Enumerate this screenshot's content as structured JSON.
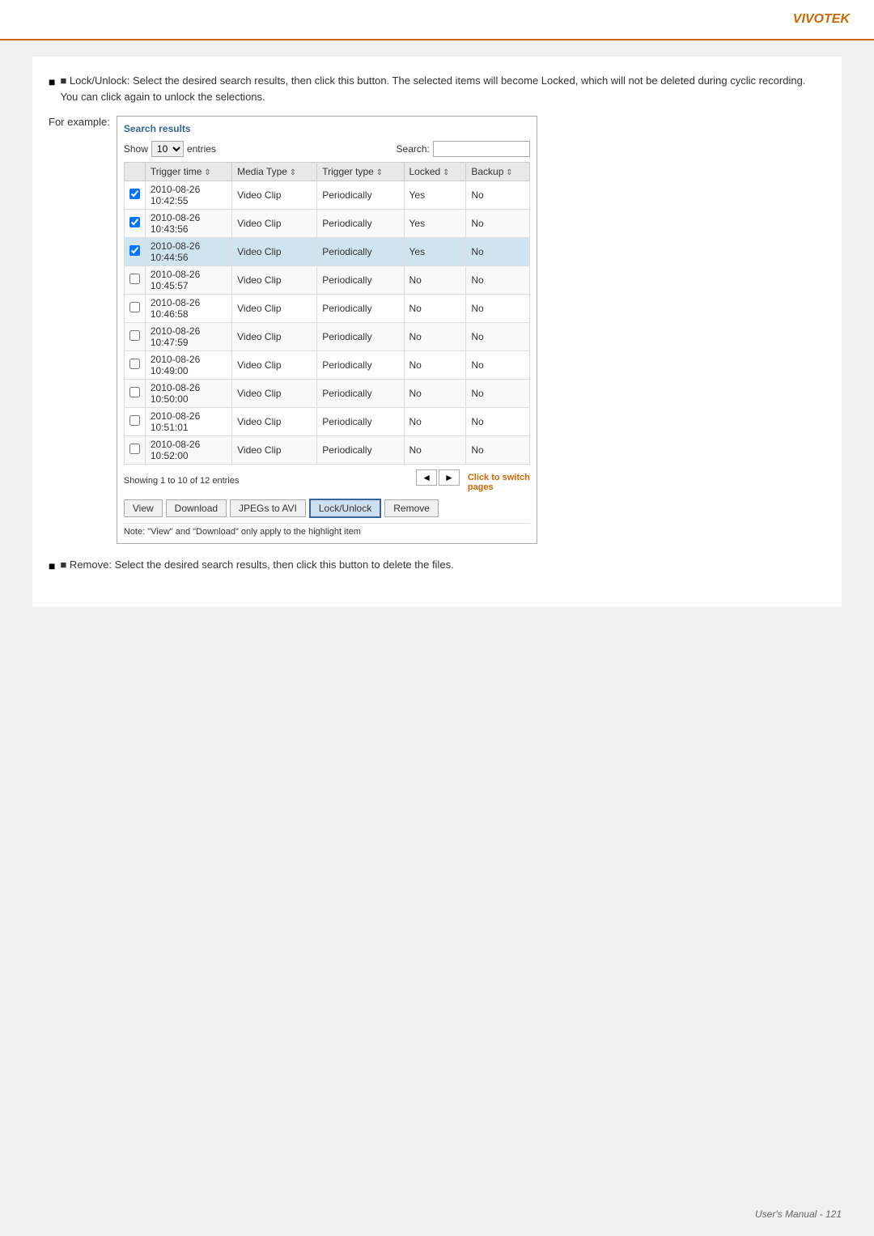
{
  "brand": "VIVOTEK",
  "footer": "User's Manual - 121",
  "instruction_lock": "■ Lock/Unlock: Select the desired search results, then click this button. The selected items will become Locked, which will not be deleted during cyclic recording. You can click again to unlock the selections.",
  "for_example_label": "For example:",
  "panel": {
    "title": "Search results",
    "show_label": "Show",
    "show_value": "10",
    "entries_label": "entries",
    "search_label": "Search:",
    "search_value": "",
    "columns": {
      "checkbox": "",
      "trigger_time": "Trigger time",
      "media_type": "Media Type",
      "trigger_type": "Trigger type",
      "locked": "Locked",
      "backup": "Backup"
    },
    "rows": [
      {
        "checked": true,
        "trigger_time": "2010-08-26\n10:42:55",
        "media_type": "Video Clip",
        "trigger_type": "Periodically",
        "locked": "Yes",
        "backup": "No",
        "highlighted": false
      },
      {
        "checked": true,
        "trigger_time": "2010-08-26\n10:43:56",
        "media_type": "Video Clip",
        "trigger_type": "Periodically",
        "locked": "Yes",
        "backup": "No",
        "highlighted": false
      },
      {
        "checked": true,
        "trigger_time": "2010-08-26\n10:44:56",
        "media_type": "Video Clip",
        "trigger_type": "Periodically",
        "locked": "Yes",
        "backup": "No",
        "highlighted": true
      },
      {
        "checked": false,
        "trigger_time": "2010-08-26\n10:45:57",
        "media_type": "Video Clip",
        "trigger_type": "Periodically",
        "locked": "No",
        "backup": "No",
        "highlighted": false
      },
      {
        "checked": false,
        "trigger_time": "2010-08-26\n10:46:58",
        "media_type": "Video Clip",
        "trigger_type": "Periodically",
        "locked": "No",
        "backup": "No",
        "highlighted": false
      },
      {
        "checked": false,
        "trigger_time": "2010-08-26\n10:47:59",
        "media_type": "Video Clip",
        "trigger_type": "Periodically",
        "locked": "No",
        "backup": "No",
        "highlighted": false
      },
      {
        "checked": false,
        "trigger_time": "2010-08-26\n10:49:00",
        "media_type": "Video Clip",
        "trigger_type": "Periodically",
        "locked": "No",
        "backup": "No",
        "highlighted": false
      },
      {
        "checked": false,
        "trigger_time": "2010-08-26\n10:50:00",
        "media_type": "Video Clip",
        "trigger_type": "Periodically",
        "locked": "No",
        "backup": "No",
        "highlighted": false
      },
      {
        "checked": false,
        "trigger_time": "2010-08-26\n10:51:01",
        "media_type": "Video Clip",
        "trigger_type": "Periodically",
        "locked": "No",
        "backup": "No",
        "highlighted": false
      },
      {
        "checked": false,
        "trigger_time": "2010-08-26\n10:52:00",
        "media_type": "Video Clip",
        "trigger_type": "Periodically",
        "locked": "No",
        "backup": "No",
        "highlighted": false
      }
    ],
    "showing_text": "Showing 1 to 10 of 12 entries",
    "prev_btn": "◄",
    "next_btn": "►",
    "annotation": "Click to switch\npages",
    "buttons": {
      "view": "View",
      "download": "Download",
      "jpegs_to_avi": "JPEGs to AVI",
      "lock_unlock": "Lock/Unlock",
      "remove": "Remove"
    },
    "note": "Note: \"View\" and \"Download\" only apply to the highlight item"
  },
  "instruction_remove": "■ Remove: Select the desired search results, then click this button to delete the files."
}
